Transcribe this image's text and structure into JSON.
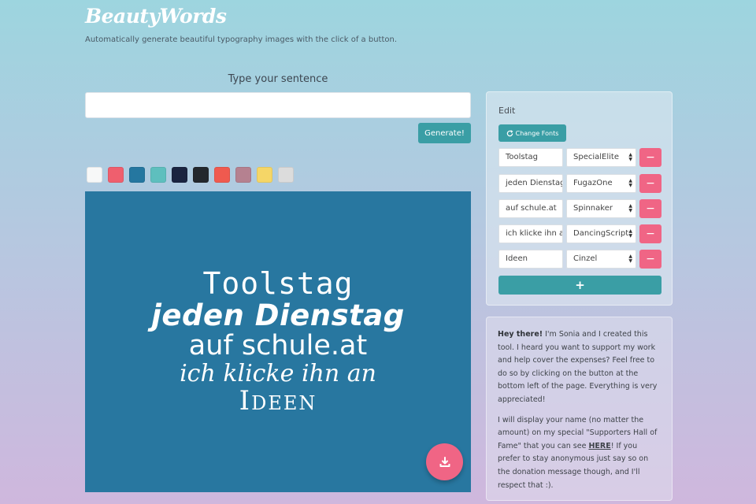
{
  "header": {
    "brand": "BeautyWords",
    "tagline": "Automatically generate beautiful typography images with the click of a button."
  },
  "sentence": {
    "label": "Type your sentence",
    "value": "",
    "generate_label": "Generate!"
  },
  "swatches": [
    "#f7f8f8",
    "#ef5f6e",
    "#2577a0",
    "#5ebfbe",
    "#1a2440",
    "#23282d",
    "#ef5a4f",
    "#b58190",
    "#f5d667",
    "#dcdcdc"
  ],
  "canvas": {
    "background": "#2877a0",
    "lines": [
      "Toolstag",
      "jeden Dienstag",
      "auf schule.at",
      "ich klicke ihn an",
      "Ideen"
    ],
    "download_icon": "download-icon"
  },
  "edit": {
    "title": "Edit",
    "change_fonts_label": "Change Fonts",
    "rows": [
      {
        "text": "Toolstag",
        "font": "SpecialElite"
      },
      {
        "text": "jeden Dienstag",
        "font": "FugazOne"
      },
      {
        "text": "auf schule.at",
        "font": "Spinnaker"
      },
      {
        "text": "ich klicke ihn an",
        "font": "DancingScript"
      },
      {
        "text": "Ideen",
        "font": "Cinzel"
      }
    ],
    "remove_label": "−",
    "add_label": "+"
  },
  "info": {
    "greeting": "Hey there!",
    "p1": " I'm Sonia and I created this tool. I heard you want to support my work and help cover the expenses? Feel free to do so by clicking on the button at the bottom left of the page. Everything is very appreciated!",
    "p2_before": "I will display your name (no matter the amount) on my special \"Supporters Hall of Fame\" that you can see ",
    "p2_link": "HERE",
    "p2_after": "! If you prefer to stay anonymous just say so on the donation message though, and I'll respect that :)."
  },
  "colors": {
    "accent": "#3a9ea5",
    "danger": "#f06585"
  }
}
